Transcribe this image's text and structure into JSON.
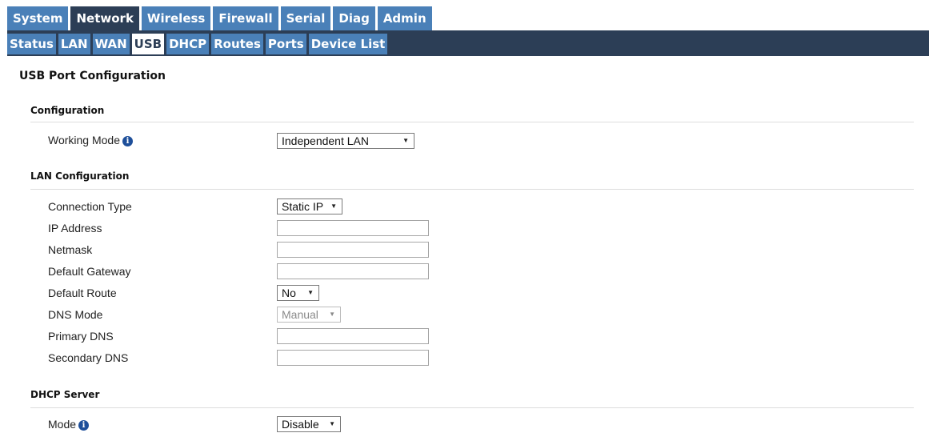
{
  "top_tabs": [
    "System",
    "Network",
    "Wireless",
    "Firewall",
    "Serial",
    "Diag",
    "Admin"
  ],
  "active_top_tab": "Network",
  "sub_tabs": [
    "Status",
    "LAN",
    "WAN",
    "USB",
    "DHCP",
    "Routes",
    "Ports",
    "Device List"
  ],
  "active_sub_tab": "USB",
  "page_title": "USB Port Configuration",
  "configuration": {
    "heading": "Configuration",
    "working_mode_label": "Working Mode",
    "working_mode_value": "Independent LAN"
  },
  "lan": {
    "heading": "LAN Configuration",
    "connection_type_label": "Connection Type",
    "connection_type_value": "Static IP",
    "ip_address_label": "IP Address",
    "ip_address_value": "",
    "netmask_label": "Netmask",
    "netmask_value": "",
    "default_gateway_label": "Default Gateway",
    "default_gateway_value": "",
    "default_route_label": "Default Route",
    "default_route_value": "No",
    "dns_mode_label": "DNS Mode",
    "dns_mode_value": "Manual",
    "primary_dns_label": "Primary DNS",
    "primary_dns_value": "",
    "secondary_dns_label": "Secondary DNS",
    "secondary_dns_value": ""
  },
  "dhcp": {
    "heading": "DHCP Server",
    "mode_label": "Mode",
    "mode_value": "Disable"
  },
  "icons": {
    "info": "info-icon",
    "dropdown": "dropdown-arrow-icon"
  },
  "colors": {
    "tab_blue": "#4a80b8",
    "tab_dark": "#2c3e56",
    "info_icon": "#1e4f9a"
  }
}
